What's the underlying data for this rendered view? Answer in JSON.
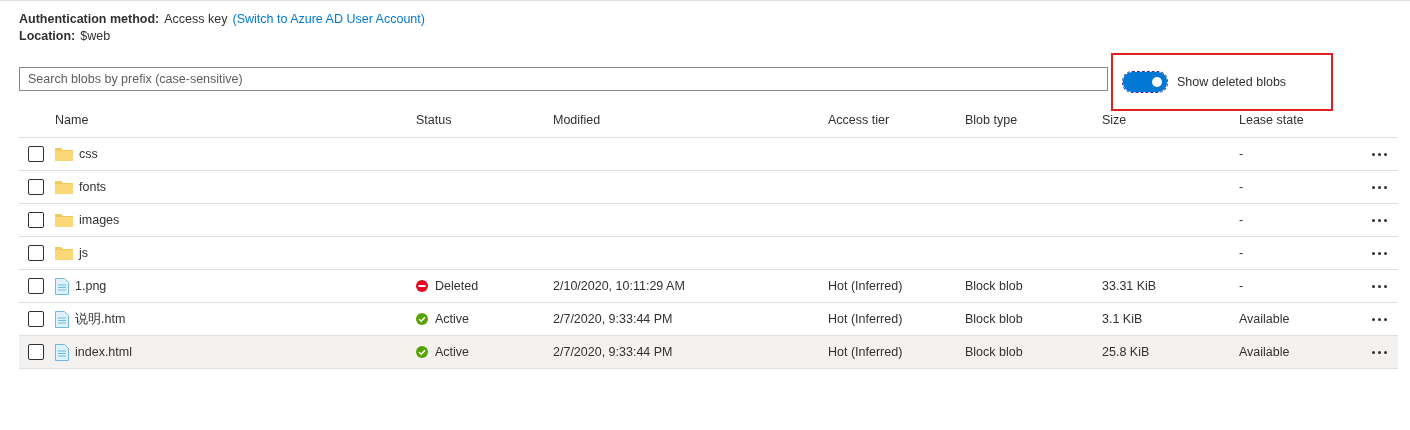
{
  "auth": {
    "label": "Authentication method:",
    "value": "Access key",
    "link": "(Switch to Azure AD User Account)"
  },
  "location": {
    "label": "Location:",
    "value": "$web"
  },
  "search": {
    "placeholder": "Search blobs by prefix (case-sensitive)"
  },
  "toggle": {
    "label": "Show deleted blobs",
    "on": true,
    "focused": true,
    "annotated": true
  },
  "table": {
    "columns": [
      "Name",
      "Status",
      "Modified",
      "Access tier",
      "Blob type",
      "Size",
      "Lease state"
    ],
    "rows": [
      {
        "kind": "folder",
        "name": "css",
        "lease_state": "-",
        "checked": false,
        "highlighted": false
      },
      {
        "kind": "folder",
        "name": "fonts",
        "lease_state": "-",
        "checked": false,
        "highlighted": false
      },
      {
        "kind": "folder",
        "name": "images",
        "lease_state": "-",
        "checked": false,
        "highlighted": false
      },
      {
        "kind": "folder",
        "name": "js",
        "lease_state": "-",
        "checked": false,
        "highlighted": false
      },
      {
        "kind": "file",
        "name": "1.png",
        "status": {
          "kind": "deleted",
          "label": "Deleted"
        },
        "modified": "2/10/2020, 10:11:29 AM",
        "access_tier": "Hot (Inferred)",
        "blob_type": "Block blob",
        "size": "33.31 KiB",
        "lease_state": "-",
        "checked": false,
        "highlighted": false
      },
      {
        "kind": "file",
        "name": "说明.htm",
        "status": {
          "kind": "active",
          "label": "Active"
        },
        "modified": "2/7/2020, 9:33:44 PM",
        "access_tier": "Hot (Inferred)",
        "blob_type": "Block blob",
        "size": "3.1 KiB",
        "lease_state": "Available",
        "checked": false,
        "highlighted": false
      },
      {
        "kind": "file",
        "name": "index.html",
        "status": {
          "kind": "active",
          "label": "Active"
        },
        "modified": "2/7/2020, 9:33:44 PM",
        "access_tier": "Hot (Inferred)",
        "blob_type": "Block blob",
        "size": "25.8 KiB",
        "lease_state": "Available",
        "checked": false,
        "highlighted": true
      }
    ]
  }
}
